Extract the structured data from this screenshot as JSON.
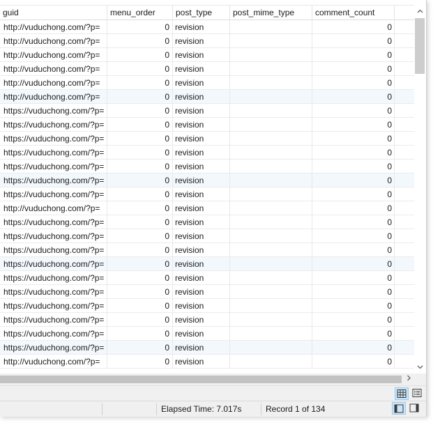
{
  "columns": [
    "guid",
    "menu_order",
    "post_type",
    "post_mime_type",
    "comment_count"
  ],
  "rows": [
    {
      "guid": "http://vuduchong.com/?p=",
      "menu_order": "0",
      "post_type": "revision",
      "post_mime_type": "",
      "comment_count": "0"
    },
    {
      "guid": "http://vuduchong.com/?p=",
      "menu_order": "0",
      "post_type": "revision",
      "post_mime_type": "",
      "comment_count": "0"
    },
    {
      "guid": "http://vuduchong.com/?p=",
      "menu_order": "0",
      "post_type": "revision",
      "post_mime_type": "",
      "comment_count": "0"
    },
    {
      "guid": "http://vuduchong.com/?p=",
      "menu_order": "0",
      "post_type": "revision",
      "post_mime_type": "",
      "comment_count": "0"
    },
    {
      "guid": "http://vuduchong.com/?p=",
      "menu_order": "0",
      "post_type": "revision",
      "post_mime_type": "",
      "comment_count": "0"
    },
    {
      "guid": "http://vuduchong.com/?p=",
      "menu_order": "0",
      "post_type": "revision",
      "post_mime_type": "",
      "comment_count": "0"
    },
    {
      "guid": "https://vuduchong.com/?p=",
      "menu_order": "0",
      "post_type": "revision",
      "post_mime_type": "",
      "comment_count": "0"
    },
    {
      "guid": "https://vuduchong.com/?p=",
      "menu_order": "0",
      "post_type": "revision",
      "post_mime_type": "",
      "comment_count": "0"
    },
    {
      "guid": "https://vuduchong.com/?p=",
      "menu_order": "0",
      "post_type": "revision",
      "post_mime_type": "",
      "comment_count": "0"
    },
    {
      "guid": "https://vuduchong.com/?p=",
      "menu_order": "0",
      "post_type": "revision",
      "post_mime_type": "",
      "comment_count": "0"
    },
    {
      "guid": "https://vuduchong.com/?p=",
      "menu_order": "0",
      "post_type": "revision",
      "post_mime_type": "",
      "comment_count": "0"
    },
    {
      "guid": "https://vuduchong.com/?p=",
      "menu_order": "0",
      "post_type": "revision",
      "post_mime_type": "",
      "comment_count": "0"
    },
    {
      "guid": "https://vuduchong.com/?p=",
      "menu_order": "0",
      "post_type": "revision",
      "post_mime_type": "",
      "comment_count": "0"
    },
    {
      "guid": "http://vuduchong.com/?p=",
      "menu_order": "0",
      "post_type": "revision",
      "post_mime_type": "",
      "comment_count": "0"
    },
    {
      "guid": "https://vuduchong.com/?p=",
      "menu_order": "0",
      "post_type": "revision",
      "post_mime_type": "",
      "comment_count": "0"
    },
    {
      "guid": "https://vuduchong.com/?p=",
      "menu_order": "0",
      "post_type": "revision",
      "post_mime_type": "",
      "comment_count": "0"
    },
    {
      "guid": "https://vuduchong.com/?p=",
      "menu_order": "0",
      "post_type": "revision",
      "post_mime_type": "",
      "comment_count": "0"
    },
    {
      "guid": "https://vuduchong.com/?p=",
      "menu_order": "0",
      "post_type": "revision",
      "post_mime_type": "",
      "comment_count": "0"
    },
    {
      "guid": "https://vuduchong.com/?p=",
      "menu_order": "0",
      "post_type": "revision",
      "post_mime_type": "",
      "comment_count": "0"
    },
    {
      "guid": "https://vuduchong.com/?p=",
      "menu_order": "0",
      "post_type": "revision",
      "post_mime_type": "",
      "comment_count": "0"
    },
    {
      "guid": "https://vuduchong.com/?p=",
      "menu_order": "0",
      "post_type": "revision",
      "post_mime_type": "",
      "comment_count": "0"
    },
    {
      "guid": "https://vuduchong.com/?p=",
      "menu_order": "0",
      "post_type": "revision",
      "post_mime_type": "",
      "comment_count": "0"
    },
    {
      "guid": "https://vuduchong.com/?p=",
      "menu_order": "0",
      "post_type": "revision",
      "post_mime_type": "",
      "comment_count": "0"
    },
    {
      "guid": "https://vuduchong.com/?p=",
      "menu_order": "0",
      "post_type": "revision",
      "post_mime_type": "",
      "comment_count": "0"
    },
    {
      "guid": "http://vuduchong.com/?p=",
      "menu_order": "0",
      "post_type": "revision",
      "post_mime_type": "",
      "comment_count": "0"
    }
  ],
  "highlighted_rows": [
    5,
    11,
    17,
    23
  ],
  "icons": {
    "scroll_up": "chevron-up-icon",
    "scroll_down": "chevron-down-icon",
    "scroll_right": "chevron-right-icon",
    "grid_view": "grid-view-icon",
    "form_view": "form-view-icon",
    "panel_left": "panel-left-icon",
    "panel_right": "panel-right-icon"
  },
  "colors": {
    "row_highlight": "#f3f8fd",
    "active_button": "#cce4f7"
  },
  "status": {
    "elapsed": "Elapsed Time: 7.017s",
    "record": "Record 1 of 134"
  }
}
